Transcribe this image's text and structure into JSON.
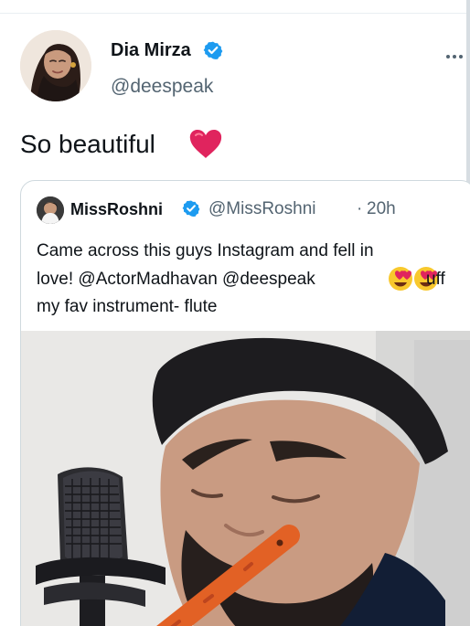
{
  "tweet": {
    "author": {
      "name": "Dia Mirza",
      "handle": "@deespeak",
      "verified": true
    },
    "text": "So beautiful",
    "emoji": "heart"
  },
  "quoted_tweet": {
    "author": {
      "name": "MissRoshni",
      "handle": "@MissRoshni",
      "verified": true
    },
    "separator": "·",
    "time": "20h",
    "lines": [
      "Came across this guys Instagram and fell in",
      "love! @ActorMadhavan @deespeak",
      "my fav instrument- flute"
    ],
    "line_2_suffix": "uff",
    "emoji": "heart-eyes x2"
  },
  "icons": {
    "verified": "verified-badge-icon",
    "more": "more-options-icon",
    "heart": "red-heart-icon",
    "media": "video-thumbnail"
  },
  "colors": {
    "verified_blue": "#1d9bf0",
    "secondary_text": "#536471",
    "border": "#cfd9de",
    "heart_red": "#e0245e"
  }
}
